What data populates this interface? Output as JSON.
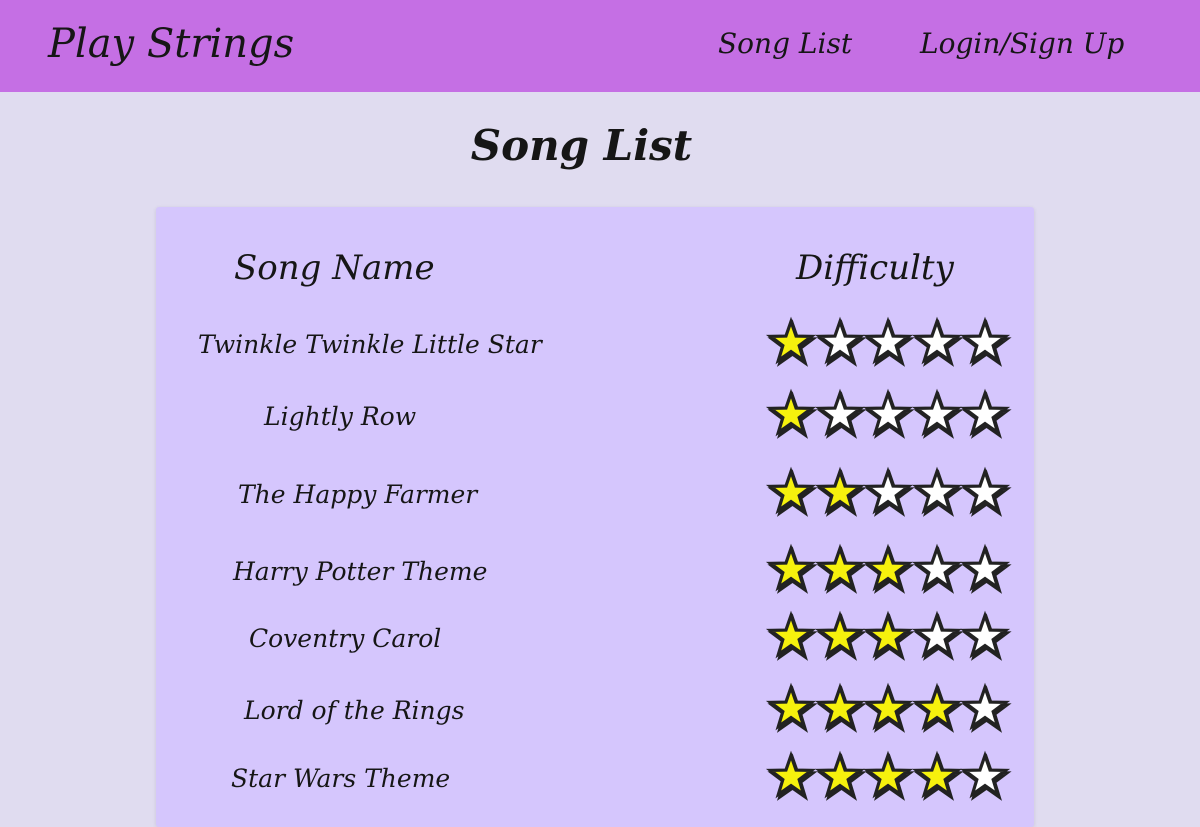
{
  "nav": {
    "brand": "Play Strings",
    "links": [
      {
        "label": "Song List"
      },
      {
        "label": "Login/Sign Up"
      }
    ]
  },
  "page": {
    "title": "Song List"
  },
  "table": {
    "headers": {
      "song_name": "Song Name",
      "difficulty": "Difficulty"
    },
    "max_rating": 5,
    "rows": [
      {
        "name": "Twinkle Twinkle Little Star",
        "difficulty": 1
      },
      {
        "name": "Lightly Row",
        "difficulty": 1
      },
      {
        "name": "The Happy Farmer",
        "difficulty": 2
      },
      {
        "name": "Harry Potter Theme",
        "difficulty": 3
      },
      {
        "name": "Coventry Carol",
        "difficulty": 3
      },
      {
        "name": "Lord of the Rings",
        "difficulty": 4
      },
      {
        "name": "Star Wars Theme",
        "difficulty": 4
      }
    ]
  },
  "colors": {
    "navbar_bg": "#c56fe4",
    "page_bg": "#e0dcf0",
    "panel_bg": "#d5c6fd",
    "star_filled": "#f6f10d",
    "star_empty": "#ffffff"
  }
}
